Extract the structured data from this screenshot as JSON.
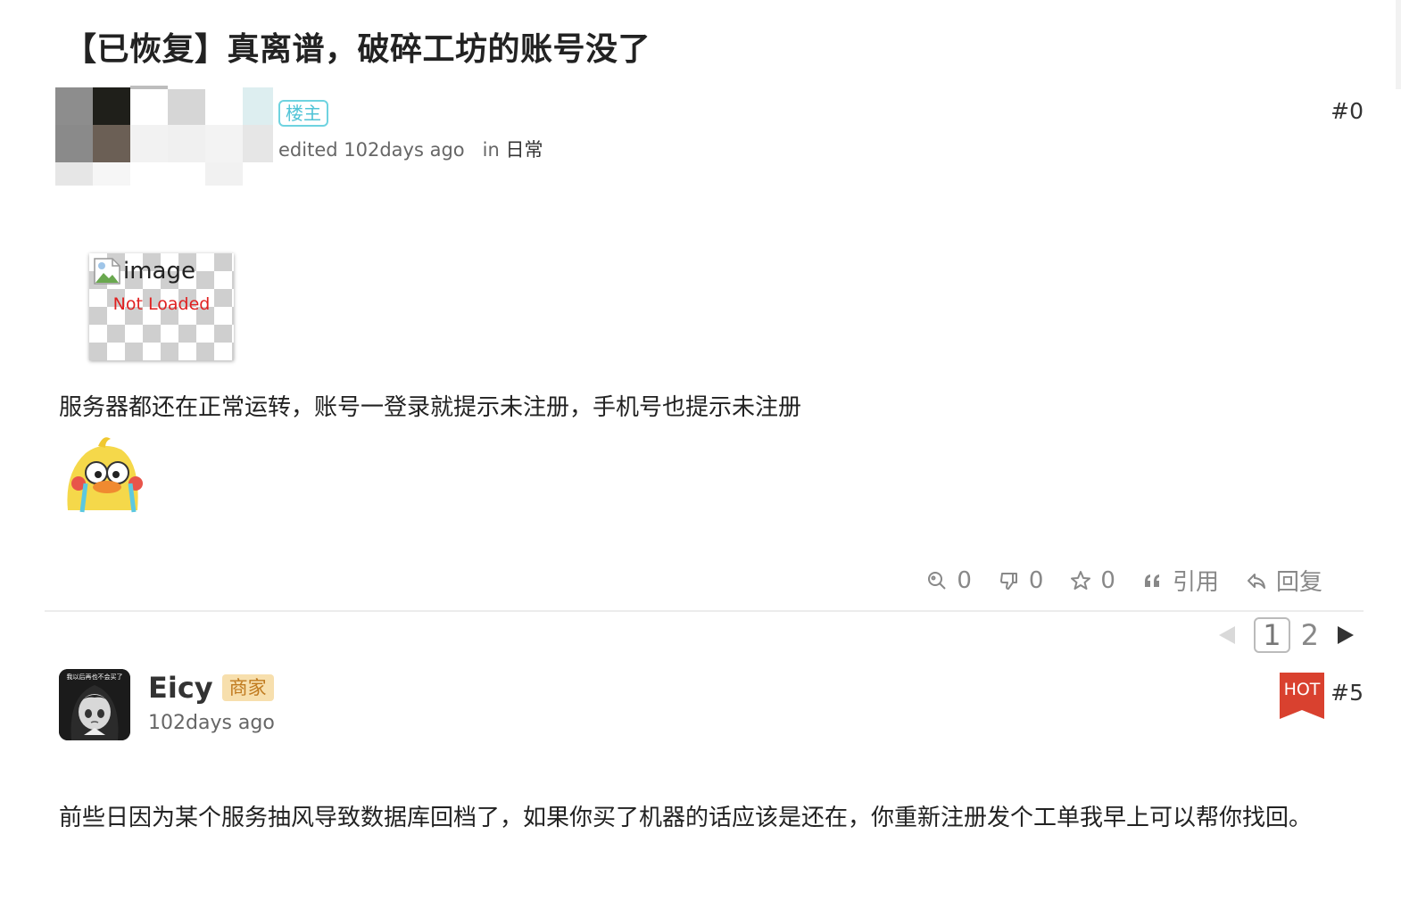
{
  "thread": {
    "title": "【已恢复】真离谱，破碎工坊的账号没了"
  },
  "op": {
    "badge": "楼主",
    "edited": "edited 102days ago",
    "in_label": "in",
    "category": "日常",
    "floor": "#0",
    "image_alt": "image",
    "image_status": "Not Loaded",
    "body": "服务器都还在正常运转，账号一登录就提示未注册，手机号也提示未注册",
    "sticker_icon": "crying-duck-sticker"
  },
  "actions": {
    "views": "0",
    "dislikes": "0",
    "stars": "0",
    "quote_label": "引用",
    "reply_label": "回复"
  },
  "pagination": {
    "pages": [
      "1",
      "2"
    ],
    "current": "1"
  },
  "reply": {
    "username": "Eicy",
    "badge": "商家",
    "time": "102days ago",
    "hot_label": "HOT",
    "floor": "#5",
    "avatar_caption": "我以后再也不会买了",
    "body": "前些日因为某个服务抽风导致数据库回档了，如果你买了机器的话应该是还在，你重新注册发个工单我早上可以帮你找回。"
  },
  "colors": {
    "owner_badge": "#4fc3d6",
    "merchant_badge_bg": "#f7dfad",
    "hot": "#d9412f",
    "not_loaded": "#e02020"
  }
}
